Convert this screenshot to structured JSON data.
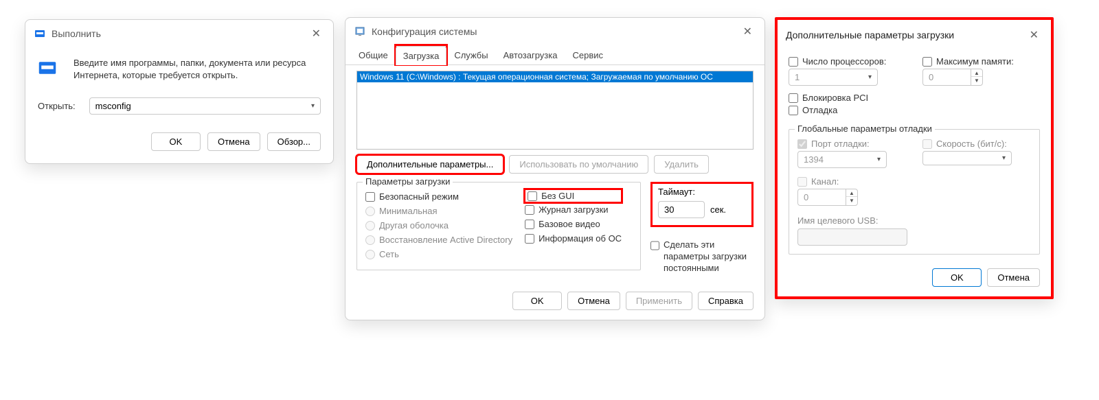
{
  "run": {
    "title": "Выполнить",
    "instructions": "Введите имя программы, папки, документа или ресурса Интернета, которые требуется открыть.",
    "open_label": "Открыть:",
    "command": "msconfig",
    "ok": "OK",
    "cancel": "Отмена",
    "browse": "Обзор..."
  },
  "sys": {
    "title": "Конфигурация системы",
    "tabs": [
      "Общие",
      "Загрузка",
      "Службы",
      "Автозагрузка",
      "Сервис"
    ],
    "active_tab": 1,
    "boot_entry": "Windows 11 (C:\\Windows) : Текущая операционная система; Загружаемая по умолчанию ОС",
    "advanced_btn": "Дополнительные параметры...",
    "default_btn": "Использовать по умолчанию",
    "delete_btn": "Удалить",
    "boot_opts_legend": "Параметры загрузки",
    "safe_mode": "Безопасный режим",
    "minimal": "Минимальная",
    "altshell": "Другая оболочка",
    "ad_restore": "Восстановление Active Directory",
    "network": "Сеть",
    "no_gui": "Без GUI",
    "bootlog": "Журнал загрузки",
    "basevideo": "Базовое видео",
    "osinfo": "Информация об ОС",
    "timeout_label": "Таймаут:",
    "timeout_value": "30",
    "timeout_sec": "сек.",
    "make_permanent": "Сделать эти параметры загрузки постоянными",
    "ok": "OK",
    "cancel": "Отмена",
    "apply": "Применить",
    "help": "Справка"
  },
  "adv": {
    "title": "Дополнительные параметры загрузки",
    "num_proc": "Число процессоров:",
    "num_proc_val": "1",
    "max_mem": "Максимум памяти:",
    "max_mem_val": "0",
    "pci_lock": "Блокировка PCI",
    "debug": "Отладка",
    "global_legend": "Глобальные параметры отладки",
    "debug_port": "Порт отладки:",
    "debug_port_val": "1394",
    "baud": "Скорость (бит/с):",
    "baud_val": "",
    "channel": "Канал:",
    "channel_val": "0",
    "usb_target": "Имя целевого USB:",
    "usb_target_val": "",
    "ok": "OK",
    "cancel": "Отмена"
  }
}
